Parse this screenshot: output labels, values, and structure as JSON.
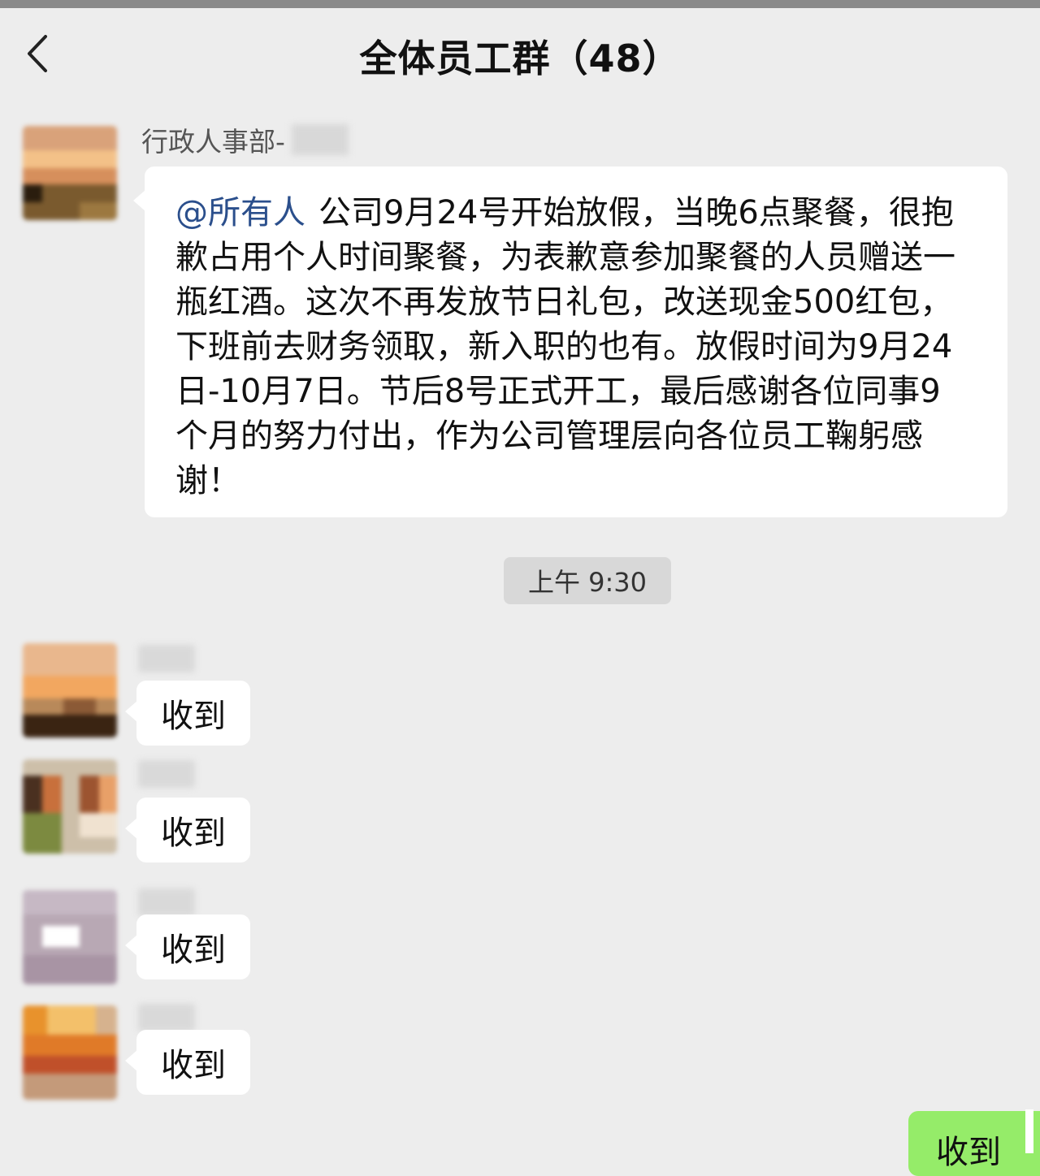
{
  "header": {
    "title": "全体员工群（48）",
    "back_icon": "chevron-left-icon"
  },
  "announcement": {
    "sender_name": "行政人事部-",
    "mention": "@所有人",
    "text": "公司9月24号开始放假，当晚6点聚餐，很抱歉占用个人时间聚餐，为表歉意参加聚餐的人员赠送一瓶红酒。这次不再发放节日礼包，改送现金500红包，下班前去财务领取，新入职的也有。放假时间为9月24日-10月7日。节后8号正式开工，最后感谢各位同事9个月的努力付出，作为公司管理层向各位员工鞠躬感谢！"
  },
  "timestamp": "上午 9:30",
  "replies": [
    {
      "text": "收到"
    },
    {
      "text": "收到"
    },
    {
      "text": "收到"
    },
    {
      "text": "收到"
    }
  ],
  "self_reply": {
    "text": "收到"
  },
  "colors": {
    "background": "#ededed",
    "bubble": "#ffffff",
    "self_bubble": "#95ec69",
    "mention": "#2b4f8c"
  }
}
